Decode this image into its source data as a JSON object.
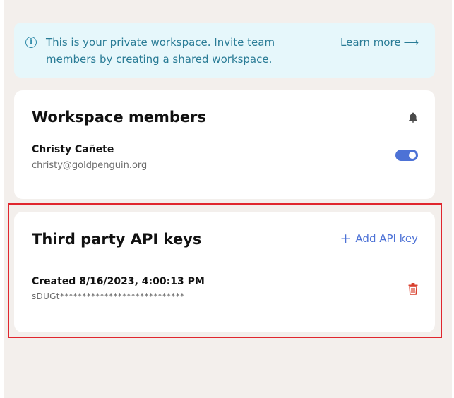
{
  "banner": {
    "text": "This is your private workspace. Invite team members by creating a shared workspace.",
    "learn_more_label": "Learn more",
    "icon": "info-icon"
  },
  "members_card": {
    "title": "Workspace members",
    "bell_icon": "bell-icon",
    "members": [
      {
        "name": "Christy Cañete",
        "email": "christy@goldpenguin.org",
        "toggle_on": true
      }
    ]
  },
  "api_keys_card": {
    "title": "Third party API keys",
    "add_label": "Add API key",
    "keys": [
      {
        "created": "Created 8/16/2023, 4:00:13 PM",
        "masked_key": "sDUGt****************************"
      }
    ]
  },
  "colors": {
    "page_bg": "#f3efec",
    "banner_bg": "#e6f7fb",
    "banner_text": "#2a7c96",
    "accent": "#4d72d6",
    "trash": "#d9412f",
    "highlight": "#e0262e"
  }
}
